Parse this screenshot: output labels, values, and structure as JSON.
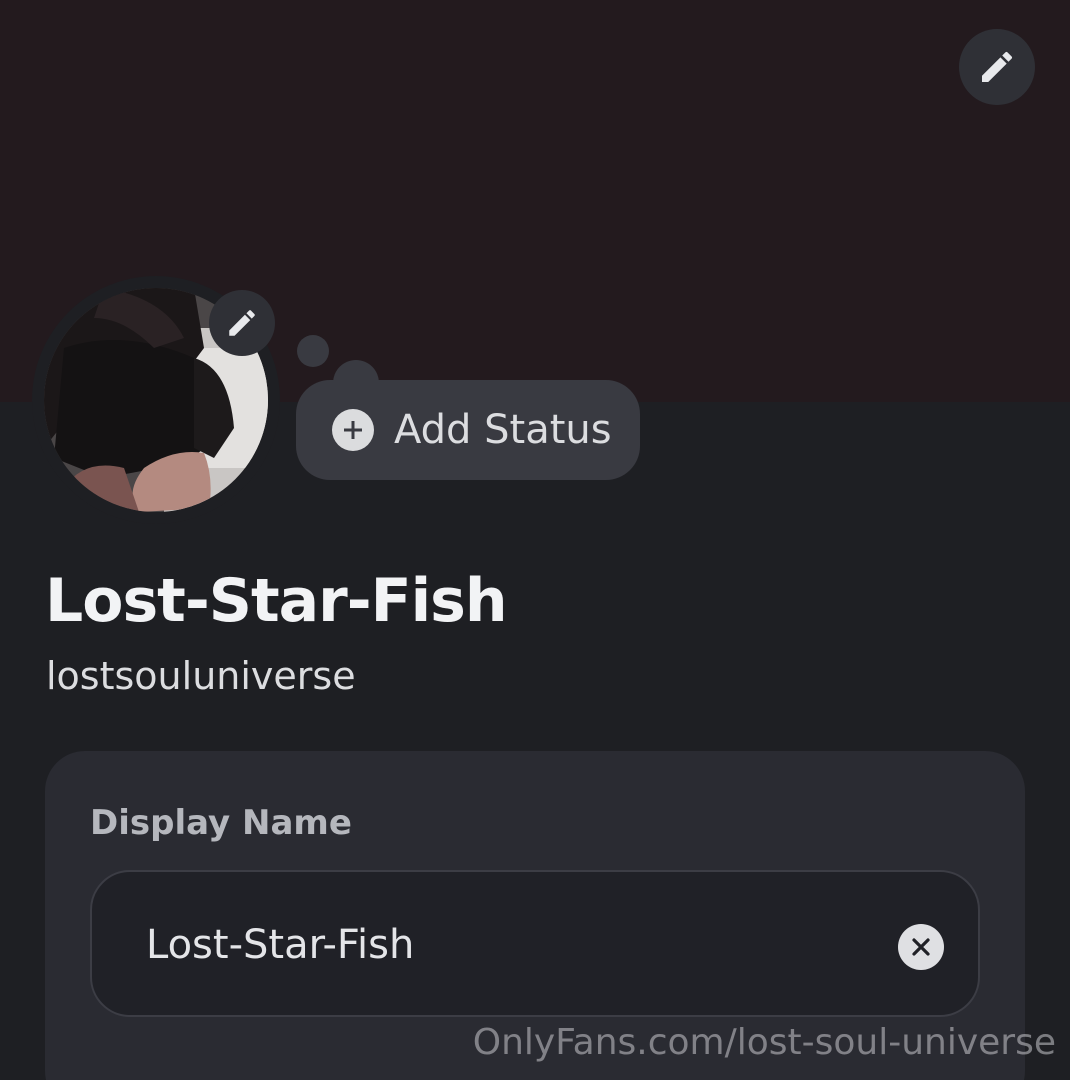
{
  "banner": {
    "color": "#231a1e",
    "edit_icon": "pencil-icon"
  },
  "avatar": {
    "edit_icon": "pencil-icon"
  },
  "status": {
    "label": "Add Status",
    "icon": "plus-circle-icon"
  },
  "profile": {
    "display_name": "Lost-Star-Fish",
    "username": "lostsouluniverse"
  },
  "form": {
    "display_name_label": "Display Name",
    "display_name_value": "Lost-Star-Fish",
    "clear_icon": "clear-icon"
  },
  "watermark": {
    "text": "OnlyFans.com/lost-soul-universe"
  },
  "colors": {
    "background": "#1e1f23",
    "card": "#2a2b32",
    "pill": "#393a41",
    "text_primary": "#f2f3f5",
    "text_muted": "#b5b7bd"
  }
}
